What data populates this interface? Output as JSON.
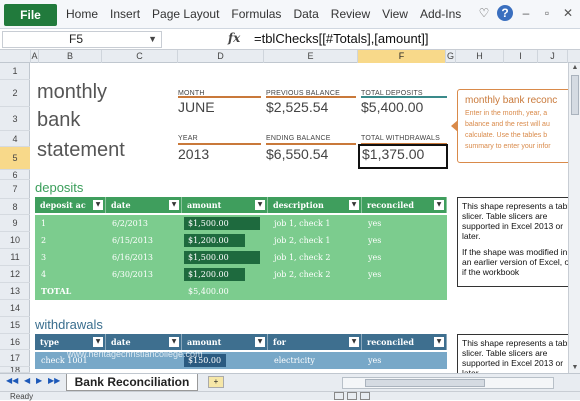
{
  "ribbon": {
    "file_tab": "File",
    "tabs": [
      "Home",
      "Insert",
      "Page Layout",
      "Formulas",
      "Data",
      "Review",
      "View",
      "Add-Ins"
    ],
    "icons": [
      "heart-icon",
      "help-icon",
      "minimize-icon",
      "restore-icon",
      "close-icon"
    ]
  },
  "formula_bar": {
    "name_box": "F5",
    "fx_label": "fx",
    "formula": "=tblChecks[[#Totals],[amount]]"
  },
  "columns": [
    "A",
    "B",
    "C",
    "D",
    "E",
    "F",
    "G",
    "H",
    "I",
    "J"
  ],
  "selected_column": "F",
  "rows": [
    "1",
    "2",
    "3",
    "4",
    "5",
    "6",
    "7",
    "8",
    "9",
    "10",
    "11",
    "12",
    "13",
    "14",
    "15",
    "16",
    "17",
    "18"
  ],
  "selected_row": "5",
  "title": {
    "line1": "monthly",
    "line2": "bank",
    "line3": "statement"
  },
  "summary": {
    "month_label": "MONTH",
    "month_value": "JUNE",
    "prev_balance_label": "PREVIOUS BALANCE",
    "prev_balance_value": "$2,525.54",
    "total_deposits_label": "TOTAL DEPOSITS",
    "total_deposits_value": "$5,400.00",
    "year_label": "YEAR",
    "year_value": "2013",
    "ending_balance_label": "ENDING BALANCE",
    "ending_balance_value": "$6,550.54",
    "total_withdrawals_label": "TOTAL WITHDRAWALS",
    "total_withdrawals_value": "$1,375.00"
  },
  "callout": {
    "title": "monthly bank reconc",
    "lines": [
      "Enter in the month, year, a",
      "balance and the rest will au",
      "calculate.  Use the tables b",
      "summary to enter your infor"
    ]
  },
  "deposits": {
    "heading": "deposits",
    "headers": [
      "deposit ac",
      "date",
      "amount",
      "description",
      "reconciled"
    ],
    "rows": [
      {
        "no": "1",
        "date": "6/2/2013",
        "amount": "$1,500.00",
        "desc": "job 1, check 1",
        "rec": "yes"
      },
      {
        "no": "2",
        "date": "6/15/2013",
        "amount": "$1,200.00",
        "desc": "job 2, check 1",
        "rec": "yes"
      },
      {
        "no": "3",
        "date": "6/16/2013",
        "amount": "$1,500.00",
        "desc": "job 1, check 2",
        "rec": "yes"
      },
      {
        "no": "4",
        "date": "6/30/2013",
        "amount": "$1,200.00",
        "desc": "job 2, check 2",
        "rec": "yes"
      }
    ],
    "total_label": "TOTAL",
    "total_value": "$5,400.00",
    "amount_fill": [
      1.0,
      0.8,
      1.0,
      0.8
    ]
  },
  "slicer_note_1": {
    "line1": "This shape represents a table slicer. Table slicers are supported in Excel 2013 or later.",
    "line2": "If the shape was modified in an earlier version of Excel, or if the workbook"
  },
  "withdrawals": {
    "heading": "withdrawals",
    "headers": [
      "type",
      "date",
      "amount",
      "for",
      "reconciled"
    ],
    "rows": [
      {
        "type": "check 1001",
        "date": "",
        "amount": "$150.00",
        "for": "electricity",
        "rec": "yes"
      }
    ],
    "amount_fill": [
      0.55
    ]
  },
  "slicer_note_2": {
    "line1": "This shape represents a table slicer. Table slicers are supported in Excel 2013 or later."
  },
  "watermark": "www.heritagechristiancollege.com",
  "sheet_tabs": {
    "active": "Bank Reconciliation"
  },
  "status": {
    "ready": "Ready"
  },
  "colors": {
    "deposits_header": "#3f9e5d",
    "deposits_row": "#7ccc8e",
    "deposits_heading": "#3a9e5a",
    "withdrawals_header": "#3e6f8f",
    "withdrawals_row": "#78a8c8",
    "withdrawals_heading": "#3a6e8e",
    "accent_orange": "#c9793a"
  }
}
